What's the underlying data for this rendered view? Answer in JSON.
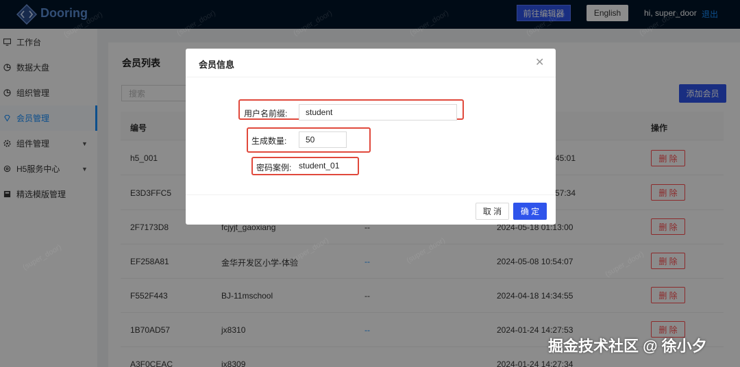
{
  "header": {
    "brand": "Dooring",
    "editor_button": "前往编辑器",
    "lang_button": "English",
    "greeting": "hi, super_door",
    "logout": "退出"
  },
  "sidebar": {
    "items": [
      {
        "label": "工作台",
        "icon": "monitor-icon"
      },
      {
        "label": "数据大盘",
        "icon": "pie-chart-icon"
      },
      {
        "label": "组织管理",
        "icon": "pie-chart-icon"
      },
      {
        "label": "会员管理",
        "icon": "diamond-icon",
        "active": true
      },
      {
        "label": "组件管理",
        "icon": "gear-icon",
        "expandable": true
      },
      {
        "label": "H5服务中心",
        "icon": "settings-icon",
        "expandable": true
      },
      {
        "label": "精选模版管理",
        "icon": "template-icon"
      }
    ]
  },
  "main": {
    "title": "会员列表",
    "search_placeholder": "搜索",
    "add_button": "添加会员",
    "columns": {
      "id": "编号",
      "action": "操作"
    },
    "delete_label": "删 除",
    "rows": [
      {
        "id": "h5_001",
        "name": "",
        "extra": "",
        "time": "45:01"
      },
      {
        "id": "E3D3FFC5",
        "name": "",
        "extra": "",
        "time": "57:34"
      },
      {
        "id": "2F7173D8",
        "name": "fcjyjt_gaoxiang",
        "extra": "--",
        "time": "2024-05-18 01:13:00"
      },
      {
        "id": "EF258A81",
        "name": "金华开发区小学-体验",
        "extra": "--",
        "time": "2024-05-08 10:54:07"
      },
      {
        "id": "F552F443",
        "name": "BJ-11mschool",
        "extra": "--",
        "time": "2024-04-18 14:34:55"
      },
      {
        "id": "1B70AD57",
        "name": "jx8310",
        "extra": "--",
        "time": "2024-01-24 14:27:53"
      },
      {
        "id": "A3F0CEAC",
        "name": "jx8309",
        "extra": "--",
        "time": "2024-01-24 14:27:34"
      }
    ]
  },
  "modal": {
    "title": "会员信息",
    "prefix_label": "用户名前缀:",
    "prefix_value": "student",
    "count_label": "生成数量:",
    "count_value": "50",
    "password_label": "密码案例:",
    "password_value": "student_01",
    "cancel_button": "取 消",
    "ok_button": "确 定"
  },
  "watermark": "(super_door)",
  "corner_watermark": "掘金技术社区 @ 徐小夕",
  "colors": {
    "header_bg": "#001529",
    "primary": "#2f54eb",
    "danger": "#ff4d4f",
    "highlight": "#e0483b"
  }
}
